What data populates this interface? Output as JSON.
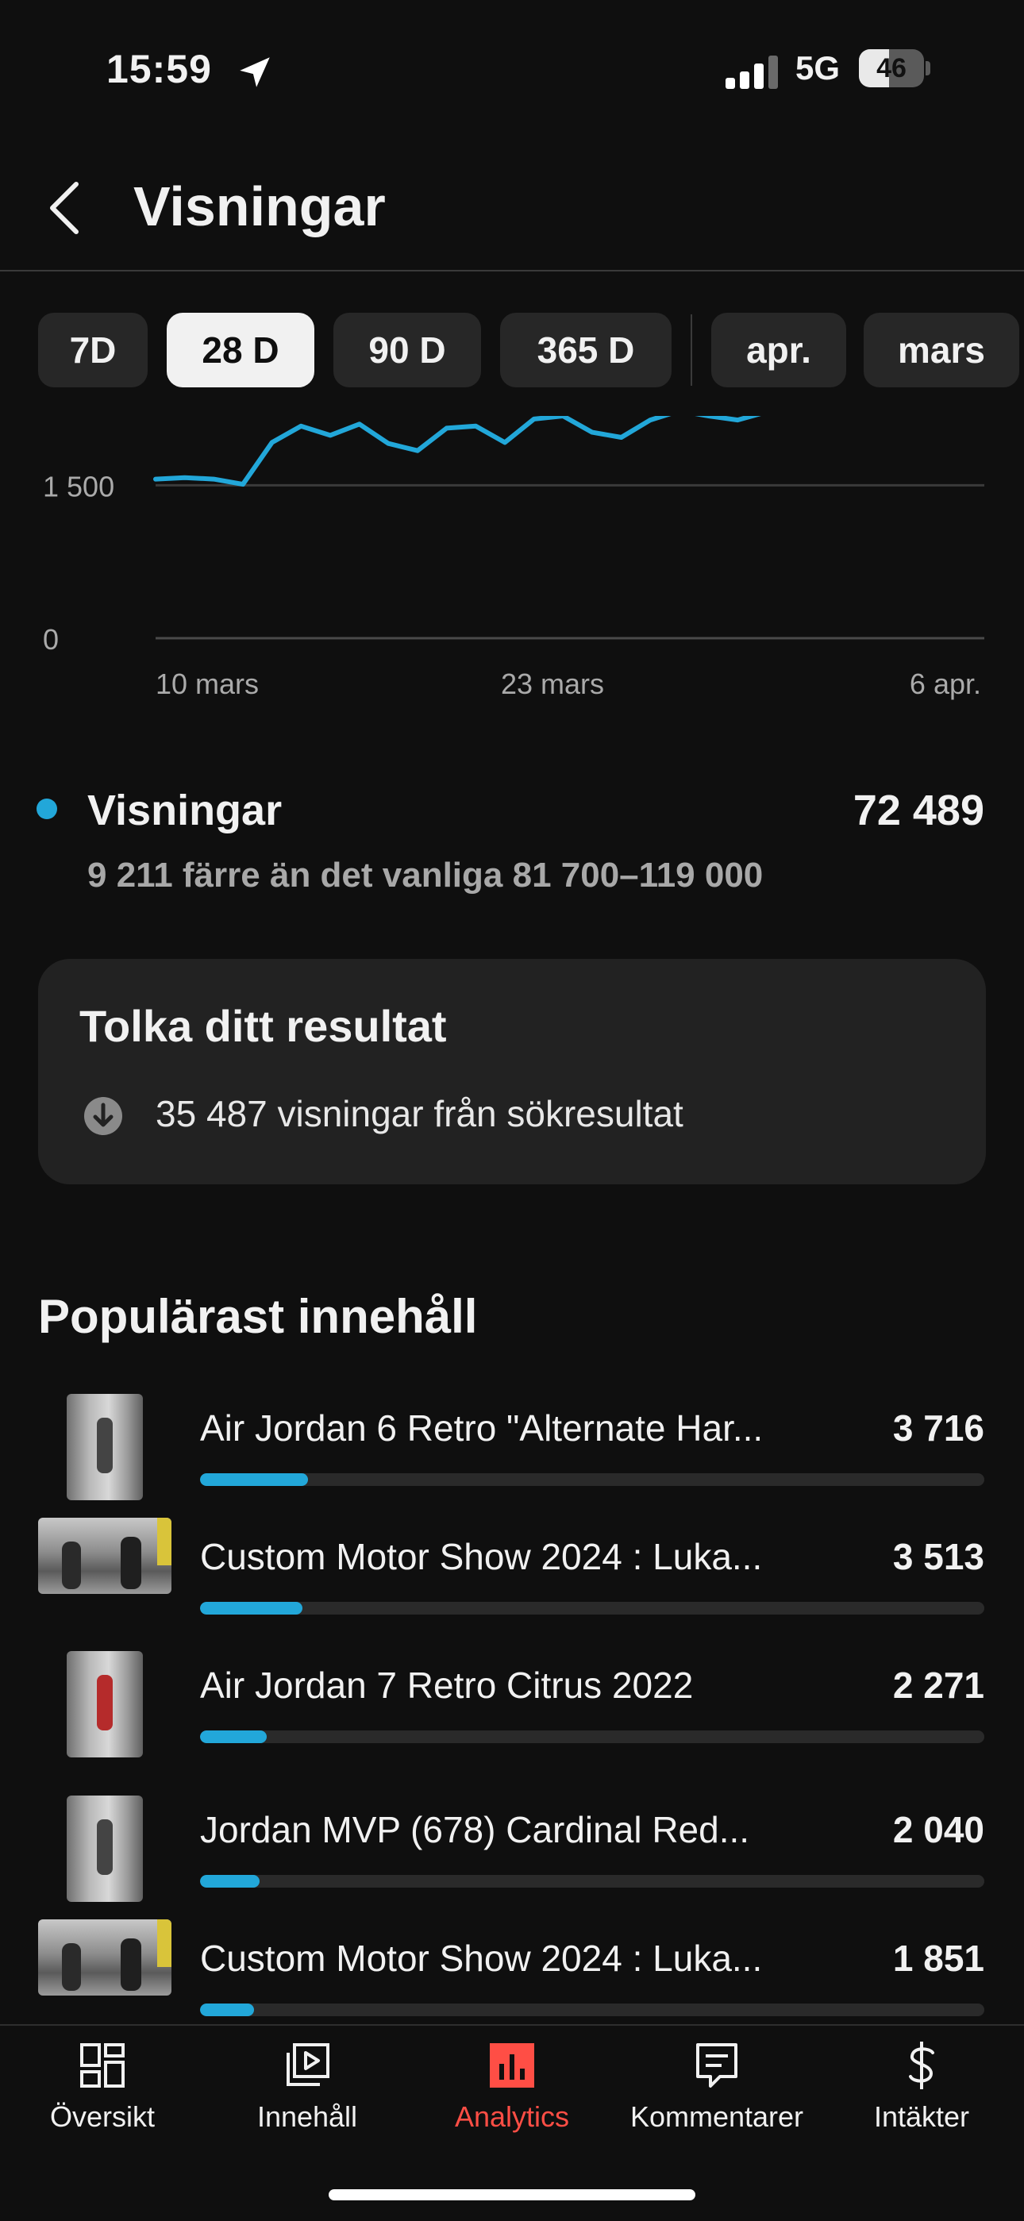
{
  "status_bar": {
    "time": "15:59",
    "network": "5G",
    "battery": "46",
    "battery_level": 0.46
  },
  "header": {
    "title": "Visningar"
  },
  "chips": [
    {
      "label": "7D",
      "active": false
    },
    {
      "label": "28 D",
      "active": true
    },
    {
      "label": "90 D",
      "active": false
    },
    {
      "label": "365 D",
      "active": false
    },
    {
      "label": "apr.",
      "active": false
    },
    {
      "label": "mars",
      "active": false
    }
  ],
  "chart_data": {
    "type": "line",
    "series": [
      {
        "values": [
          1560,
          1575,
          1560,
          1510,
          1920,
          2080,
          1990,
          2100,
          1910,
          1840,
          2060,
          2080,
          1920,
          2150,
          2180,
          2020,
          1970,
          2140,
          2230,
          2180,
          2140,
          2220
        ]
      }
    ],
    "x_tick_labels": [
      "10 mars",
      "23 mars",
      "6 apr."
    ],
    "y_tick_labels": [
      "0",
      "1 500"
    ],
    "y_ticks": [
      0,
      1500
    ],
    "ylim": [
      0,
      2180
    ],
    "color": "#22a7d9",
    "grid": true
  },
  "legend": {
    "label": "Visningar",
    "value": "72 489",
    "note": "9 211 färre än det vanliga 81 700–119 000"
  },
  "insight_card": {
    "title": "Tolka ditt resultat",
    "text": "35 487 visningar från sökresultat",
    "icon": "arrow-down-circle-icon"
  },
  "popular": {
    "title": "Populärast innehåll",
    "items": [
      {
        "title": "Air Jordan 6 Retro \"Alternate Har...",
        "value": "3 716",
        "share": 0.138,
        "thumb": "portrait"
      },
      {
        "title": "Custom Motor Show 2024 : Luka...",
        "value": "3 513",
        "share": 0.131,
        "thumb": "landscape"
      },
      {
        "title": "Air Jordan 7 Retro Citrus 2022",
        "value": "2 271",
        "share": 0.085,
        "thumb": "portrait"
      },
      {
        "title": "Jordan MVP (678) Cardinal Red...",
        "value": "2 040",
        "share": 0.076,
        "thumb": "portrait"
      },
      {
        "title": "Custom Motor Show 2024 : Luka...",
        "value": "1 851",
        "share": 0.069,
        "thumb": "landscape"
      }
    ]
  },
  "bottom_nav": [
    {
      "label": "Översikt",
      "icon": "dashboard-icon",
      "active": false
    },
    {
      "label": "Innehåll",
      "icon": "content-icon",
      "active": false
    },
    {
      "label": "Analytics",
      "icon": "analytics-icon",
      "active": true
    },
    {
      "label": "Kommentarer",
      "icon": "comments-icon",
      "active": false
    },
    {
      "label": "Intäkter",
      "icon": "dollar-icon",
      "active": false
    }
  ]
}
